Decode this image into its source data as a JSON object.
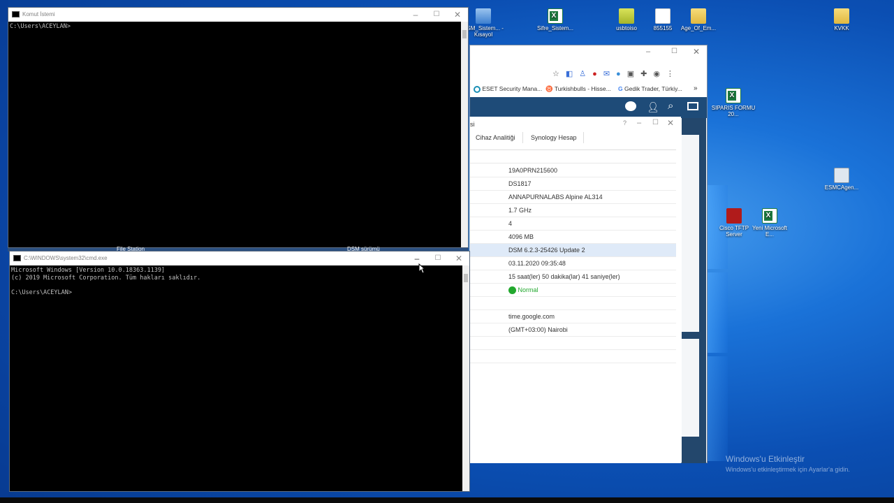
{
  "desktop": {
    "icons": [
      {
        "label": "BSM_Sistem... - Kısayol",
        "icon": "network-shortcut-icon"
      },
      {
        "label": "Sifre_Sistem...",
        "icon": "excel-file-icon"
      },
      {
        "label": "usbtoiso",
        "icon": "usb-app-icon"
      },
      {
        "label": "855155",
        "icon": "document-icon"
      },
      {
        "label": "Age_Of_Em...",
        "icon": "folder-icon"
      },
      {
        "label": "KVKK",
        "icon": "folder-icon"
      },
      {
        "label": "SIPARIS FORMU 20...",
        "icon": "excel-file-icon"
      },
      {
        "label": "ESMCAgen...",
        "icon": "installer-icon"
      },
      {
        "label": "Cisco TFTP Server",
        "icon": "cisco-icon"
      },
      {
        "label": "Yeni Microsoft E...",
        "icon": "excel-file-icon"
      }
    ],
    "activation": {
      "title": "Windows'u Etkinleştir",
      "subtitle": "Windows'u etkinleştirmek için Ayarlar'a gidin."
    }
  },
  "cmd1": {
    "title": "Komut İstemi",
    "lines": "C:\\Users\\ACEYLAN>"
  },
  "cmd2": {
    "title": "C:\\WINDOWS\\system32\\cmd.exe",
    "lines": "Microsoft Windows [Version 10.0.18363.1139]\n(c) 2019 Microsoft Corporation. Tüm hakları saklıdır.\n\nC:\\Users\\ACEYLAN>"
  },
  "background_taskbar": {
    "item1": "File Station",
    "item2": "DSM sürümü"
  },
  "browser": {
    "bookmarks": [
      {
        "label": "ESET Security Mana...",
        "icon": "eset-icon"
      },
      {
        "label": "Turkishbulls - Hisse...",
        "icon": "bull-icon"
      },
      {
        "label": "Gedik Trader, Türkiy...",
        "icon": "google-icon"
      }
    ],
    "more_label": "»"
  },
  "synology": {
    "title_fragment": "si",
    "tabs": [
      "Cihaz Analitiği",
      "Synology Hesap"
    ],
    "rows": [
      "19A0PRN215600",
      "DS1817",
      "ANNAPURNALABS Alpine AL314",
      "1.7 GHz",
      "4",
      "4096 MB",
      "DSM 6.2.3-25426 Update 2",
      "03.11.2020 09:35:48",
      "15 saat(ler) 50 dakika(lar) 41 saniye(ler)",
      "Normal",
      "",
      "time.google.com",
      "(GMT+03:00) Nairobi"
    ],
    "status_color": "#22a82e"
  }
}
